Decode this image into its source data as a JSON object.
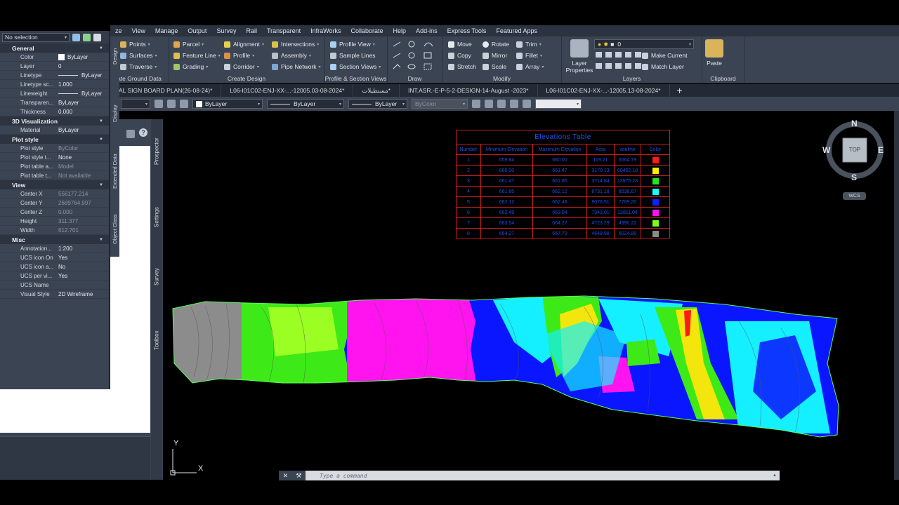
{
  "menubar": [
    "ze",
    "View",
    "Manage",
    "Output",
    "Survey",
    "Rail",
    "Transparent",
    "InfraWorks",
    "Collaborate",
    "Help",
    "Add-ins",
    "Express Tools",
    "Featured Apps"
  ],
  "ribbon": {
    "ground": {
      "title": "ate Ground Data",
      "items": [
        "Points",
        "Surfaces",
        "Traverse"
      ]
    },
    "create_design": {
      "title": "Create Design",
      "items": [
        "Parcel",
        "Feature Line",
        "Grading",
        "Alignment",
        "Profile",
        "Corridor",
        "Intersections",
        "Assembly",
        "Pipe Network"
      ]
    },
    "profile_section": {
      "title": "Profile & Section Views",
      "items": [
        "Profile View",
        "Sample Lines",
        "Section Views"
      ]
    },
    "draw": {
      "title": "Draw"
    },
    "modify": {
      "title": "Modify",
      "items": [
        "Move",
        "Copy",
        "Stretch",
        "Rotate",
        "Mirror",
        "Scale",
        "Trim",
        "Fillet",
        "Array"
      ]
    },
    "layers": {
      "title": "Layers",
      "layer_properties": "Layer Properties",
      "layer_value": "0",
      "make_current": "Make Current",
      "match_layer": "Match Layer"
    },
    "clipboard": {
      "title": "Clipboard",
      "paste": "Paste"
    }
  },
  "tabs": [
    "AL SIGN BOARD PLAN(26-08-24)*",
    "L06-I01C02-ENJ-XX-...-12005.03-08-2024*",
    "مستطيلات*",
    "INT.ASR.-E-P-5-2-DESIGN-14-August -2023*",
    "L06-I01C02-ENJ-XX-...-12005.13-08-2024*",
    "+"
  ],
  "proprow": {
    "color": "ByLayer",
    "linetype": "ByLayer",
    "lineweight": "ByLayer",
    "plotstyle": "ByColor"
  },
  "properties": {
    "selection": "No selection",
    "sections": [
      {
        "title": "General",
        "rows": [
          {
            "k": "Color",
            "v": "ByLayer"
          },
          {
            "k": "Layer",
            "v": "0"
          },
          {
            "k": "Linetype",
            "v": "ByLayer"
          },
          {
            "k": "Linetype sc...",
            "v": "1.000"
          },
          {
            "k": "Lineweight",
            "v": "ByLayer"
          },
          {
            "k": "Transparen...",
            "v": "ByLayer"
          },
          {
            "k": "Thickness",
            "v": "0.000"
          }
        ]
      },
      {
        "title": "3D Visualization",
        "rows": [
          {
            "k": "Material",
            "v": "ByLayer"
          }
        ]
      },
      {
        "title": "Plot style",
        "rows": [
          {
            "k": "Plot style",
            "v": "ByColor"
          },
          {
            "k": "Plot style t...",
            "v": "None"
          },
          {
            "k": "Plot table a...",
            "v": "Model"
          },
          {
            "k": "Plot table t...",
            "v": "Not available"
          }
        ]
      },
      {
        "title": "View",
        "rows": [
          {
            "k": "Center X",
            "v": "556177.214"
          },
          {
            "k": "Center Y",
            "v": "2689764.997"
          },
          {
            "k": "Center Z",
            "v": "0.000"
          },
          {
            "k": "Height",
            "v": "311.377"
          },
          {
            "k": "Width",
            "v": "612.701"
          }
        ]
      },
      {
        "title": "Misc",
        "rows": [
          {
            "k": "Annotation...",
            "v": "1:200"
          },
          {
            "k": "UCS icon On",
            "v": "Yes"
          },
          {
            "k": "UCS icon a...",
            "v": "No"
          },
          {
            "k": "UCS per vi...",
            "v": "Yes"
          },
          {
            "k": "UCS Name",
            "v": ""
          },
          {
            "k": "Visual Style",
            "v": "2D Wireframe"
          }
        ]
      }
    ],
    "vtabs": [
      "Design",
      "Display",
      "Extended Data",
      "Object Class"
    ]
  },
  "toolspace_vtabs": [
    "Prospector",
    "Settings",
    "Survey",
    "Toolbox"
  ],
  "elevations": {
    "title": "Elevations Table",
    "headers": [
      "Number",
      "Minimum Elevation",
      "Maximum Elevation",
      "Area",
      "voulme",
      "Color"
    ],
    "rows": [
      {
        "n": "1",
        "min": "659.84",
        "max": "660.00",
        "area": "119.21",
        "vol": "6564.79",
        "color": "#ff1a1a"
      },
      {
        "n": "2",
        "min": "660.00",
        "max": "661.47",
        "area": "3170.13",
        "vol": "60402.18",
        "color": "#ffee00"
      },
      {
        "n": "3",
        "min": "661.47",
        "max": "661.85",
        "area": "3714.84",
        "vol": "13975.28",
        "color": "#22e61c"
      },
      {
        "n": "4",
        "min": "661.85",
        "max": "662.12",
        "area": "8731.18",
        "vol": "8538.67",
        "color": "#14ffff"
      },
      {
        "n": "5",
        "min": "662.12",
        "max": "662.48",
        "area": "9076.51",
        "vol": "7769.20",
        "color": "#1022ff"
      },
      {
        "n": "6",
        "min": "662.48",
        "max": "663.54",
        "area": "7943.01",
        "vol": "13811.04",
        "color": "#ff10ff"
      },
      {
        "n": "7",
        "min": "663.54",
        "max": "664.27",
        "area": "4723.29",
        "vol": "4990.22",
        "color": "#7aff14"
      },
      {
        "n": "8",
        "min": "664.27",
        "max": "667.70",
        "area": "4648.98",
        "vol": "6024.89",
        "color": "#8a8a8a"
      }
    ]
  },
  "viewcube": {
    "n": "N",
    "s": "S",
    "e": "E",
    "w": "W",
    "face": "TOP",
    "wcs": "WCS"
  },
  "ucs": {
    "x": "X",
    "y": "Y"
  },
  "command": {
    "placeholder": "Type a command"
  },
  "colors": {
    "ribbon": "#3b4453",
    "table_border": "#cc1e1e",
    "table_text": "#1c4ee8"
  }
}
